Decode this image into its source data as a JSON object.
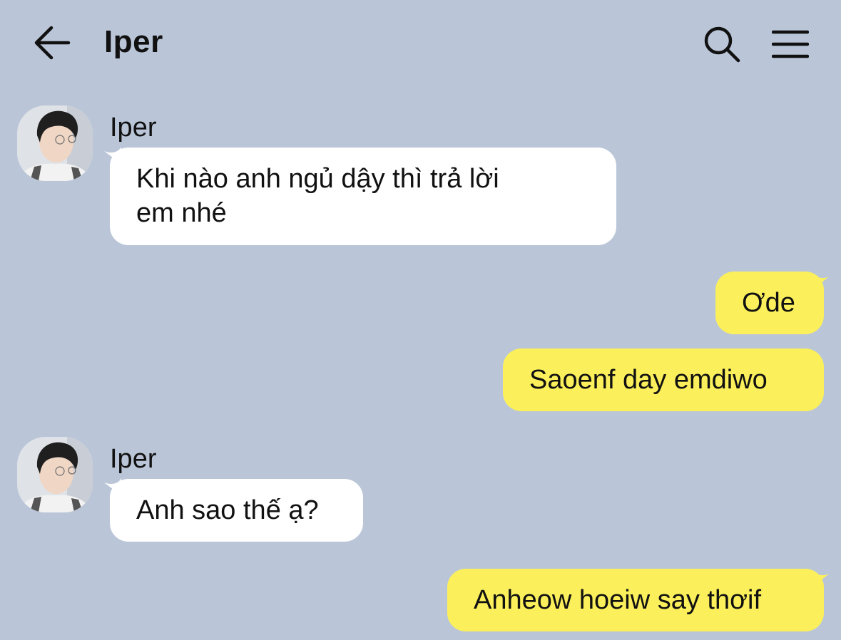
{
  "header": {
    "title": "Iper",
    "back_icon": "back-arrow-icon",
    "search_icon": "search-icon",
    "menu_icon": "hamburger-menu-icon"
  },
  "colors": {
    "background": "#bac6d8",
    "incoming_bubble": "#ffffff",
    "outgoing_bubble": "#fbf05b",
    "text": "#111111"
  },
  "messages": [
    {
      "direction": "incoming",
      "sender": "Iper",
      "text": "Khi nào anh ngủ dậy thì trả lời\nem nhé"
    },
    {
      "direction": "outgoing",
      "text": "Ơde"
    },
    {
      "direction": "outgoing",
      "text": "Saoenf day emdiwo"
    },
    {
      "direction": "incoming",
      "sender": "Iper",
      "text": "Anh sao thế ạ?"
    },
    {
      "direction": "outgoing",
      "text": "Anheow hoeiw say thơif"
    }
  ]
}
